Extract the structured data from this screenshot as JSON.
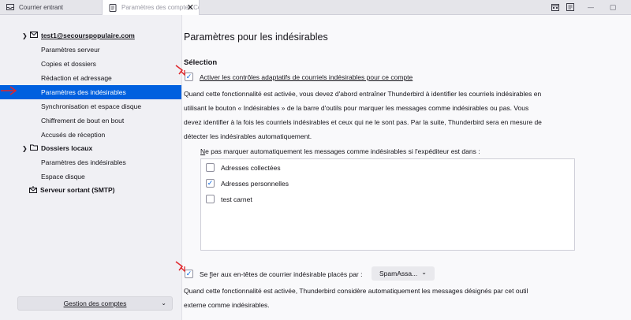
{
  "tabs": [
    {
      "label": "Courrier entrant",
      "icon": "inbox-icon"
    },
    {
      "label": "Paramètres des comptes Co",
      "icon": "settings-page-icon",
      "close": "✕"
    }
  ],
  "window_controls": {
    "minimize": "—",
    "maximize": "▢"
  },
  "sidebar": {
    "account": "test1@secourspopulaire.com",
    "account_items": [
      "Paramètres serveur",
      "Copies et dossiers",
      "Rédaction et adressage",
      "Paramètres des indésirables",
      "Synchronisation et espace disque",
      "Chiffrement de bout en bout",
      "Accusés de réception"
    ],
    "local_folders": "Dossiers locaux",
    "local_items": [
      "Paramètres des indésirables",
      "Espace disque"
    ],
    "smtp": "Serveur sortant (SMTP)",
    "manage_button": "Gestion des comptes"
  },
  "main": {
    "title": "Paramètres pour les indésirables",
    "section_title": "Sélection",
    "adaptive_checkbox_label": "Activer les contrôles adaptatifs de courriels indésirables pour ce compte",
    "adaptive_paragraph_lines": [
      "Quand cette fonctionnalité est activée, vous devez d'abord entraîner Thunderbird à identifier les courriels indésirables en",
      "utilisant le bouton « Indésirables » de la barre d'outils pour marquer les messages comme indésirables ou pas. Vous",
      "devez identifier à la fois les courriels indésirables et ceux qui ne le sont pas. Par la suite, Thunderbird sera en mesure de",
      "détecter les indésirables automatiquement."
    ],
    "whitelist_label_first": "N",
    "whitelist_label_rest": "e pas marquer automatiquement les messages comme indésirables si l'expéditeur est dans :",
    "address_books": [
      {
        "label": "Adresses collectées",
        "checked": false
      },
      {
        "label": "Adresses personnelles",
        "checked": true
      },
      {
        "label": "test carnet",
        "checked": false
      }
    ],
    "trust_headers_label_prefix": "Se ",
    "trust_headers_label_accel": "f",
    "trust_headers_label_suffix": "ier aux en-têtes de courrier indésirable placés par :",
    "trust_headers_select": "SpamAssa...",
    "trust_paragraph_lines": [
      "Quand cette fonctionnalité est activée, Thunderbird considère automatiquement les messages désignés par cet outil",
      "externe comme indésirables."
    ]
  },
  "colors": {
    "accent": "#0060df",
    "annotation": "#e0252a"
  }
}
